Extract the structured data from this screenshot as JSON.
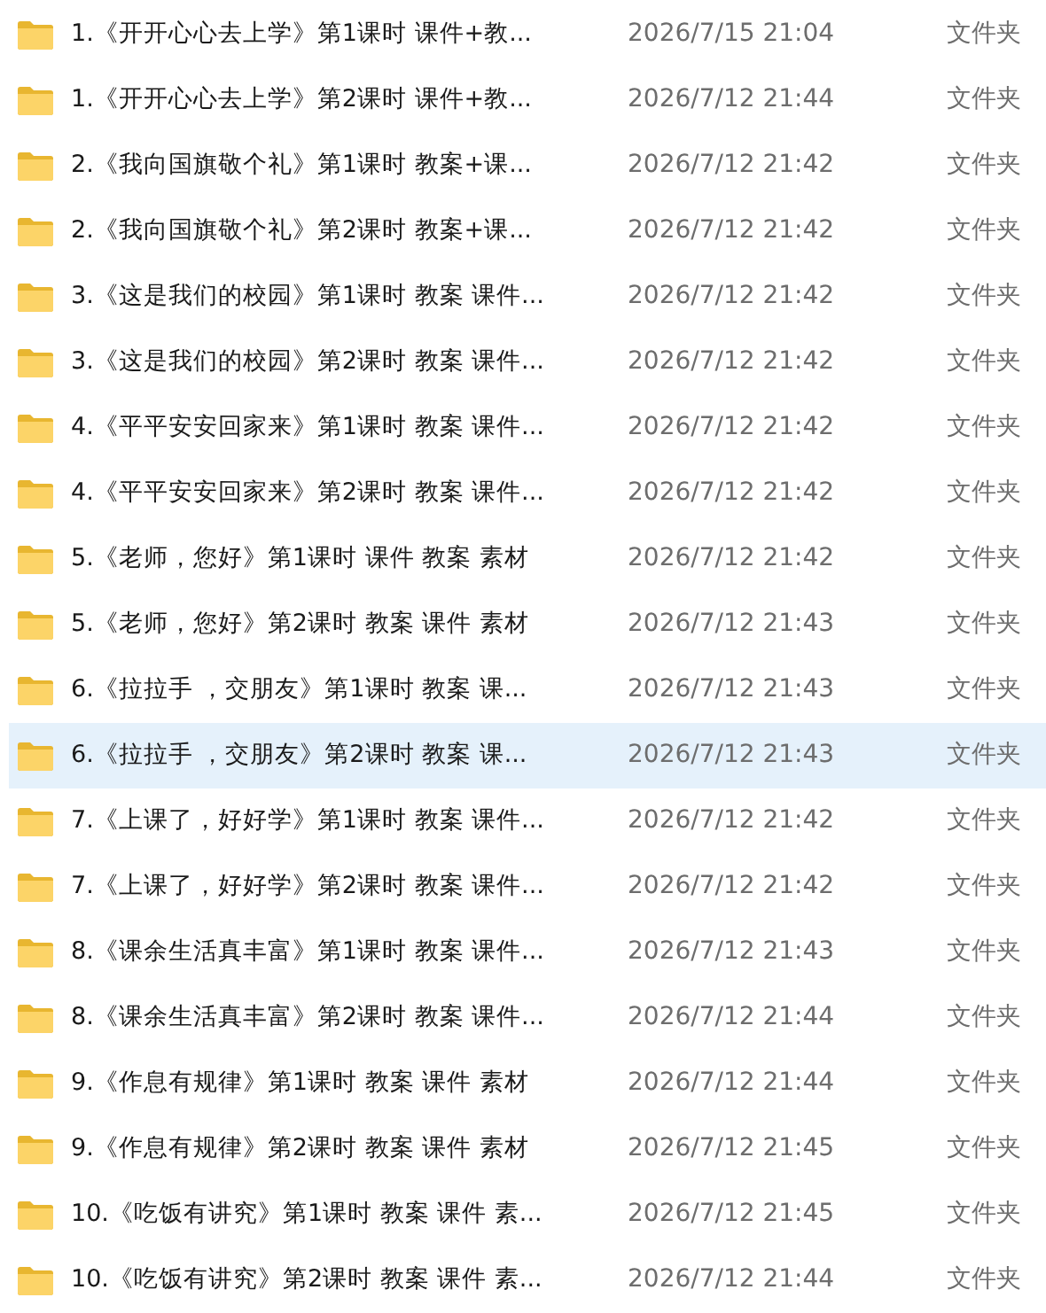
{
  "files": [
    {
      "name": "1.《开开心心去上学》第1课时 课件+教...",
      "modified": "2026/7/15 21:04",
      "type": "文件夹",
      "selected": false
    },
    {
      "name": "1.《开开心心去上学》第2课时 课件+教...",
      "modified": "2026/7/12 21:44",
      "type": "文件夹",
      "selected": false
    },
    {
      "name": "2.《我向国旗敬个礼》第1课时 教案+课...",
      "modified": "2026/7/12 21:42",
      "type": "文件夹",
      "selected": false
    },
    {
      "name": "2.《我向国旗敬个礼》第2课时 教案+课...",
      "modified": "2026/7/12 21:42",
      "type": "文件夹",
      "selected": false
    },
    {
      "name": "3.《这是我们的校园》第1课时 教案 课件...",
      "modified": "2026/7/12 21:42",
      "type": "文件夹",
      "selected": false
    },
    {
      "name": "3.《这是我们的校园》第2课时 教案 课件...",
      "modified": "2026/7/12 21:42",
      "type": "文件夹",
      "selected": false
    },
    {
      "name": "4.《平平安安回家来》第1课时 教案 课件...",
      "modified": "2026/7/12 21:42",
      "type": "文件夹",
      "selected": false
    },
    {
      "name": "4.《平平安安回家来》第2课时 教案 课件...",
      "modified": "2026/7/12 21:42",
      "type": "文件夹",
      "selected": false
    },
    {
      "name": "5.《老师，您好》第1课时 课件 教案 素材",
      "modified": "2026/7/12 21:42",
      "type": "文件夹",
      "selected": false
    },
    {
      "name": "5.《老师，您好》第2课时 教案 课件 素材",
      "modified": "2026/7/12 21:43",
      "type": "文件夹",
      "selected": false
    },
    {
      "name": "6.《拉拉手 ，交朋友》第1课时 教案 课...",
      "modified": "2026/7/12 21:43",
      "type": "文件夹",
      "selected": false
    },
    {
      "name": "6.《拉拉手 ，交朋友》第2课时 教案 课...",
      "modified": "2026/7/12 21:43",
      "type": "文件夹",
      "selected": true
    },
    {
      "name": "7.《上课了，好好学》第1课时 教案 课件...",
      "modified": "2026/7/12 21:42",
      "type": "文件夹",
      "selected": false
    },
    {
      "name": "7.《上课了，好好学》第2课时 教案 课件...",
      "modified": "2026/7/12 21:42",
      "type": "文件夹",
      "selected": false
    },
    {
      "name": "8.《课余生活真丰富》第1课时 教案 课件...",
      "modified": "2026/7/12 21:43",
      "type": "文件夹",
      "selected": false
    },
    {
      "name": "8.《课余生活真丰富》第2课时 教案 课件...",
      "modified": "2026/7/12 21:44",
      "type": "文件夹",
      "selected": false
    },
    {
      "name": "9.《作息有规律》第1课时 教案 课件 素材",
      "modified": "2026/7/12 21:44",
      "type": "文件夹",
      "selected": false
    },
    {
      "name": "9.《作息有规律》第2课时 教案 课件 素材",
      "modified": "2026/7/12 21:45",
      "type": "文件夹",
      "selected": false
    },
    {
      "name": "10.《吃饭有讲究》第1课时 教案 课件 素...",
      "modified": "2026/7/12 21:45",
      "type": "文件夹",
      "selected": false
    },
    {
      "name": "10.《吃饭有讲究》第2课时 教案 课件 素...",
      "modified": "2026/7/12 21:44",
      "type": "文件夹",
      "selected": false
    }
  ]
}
